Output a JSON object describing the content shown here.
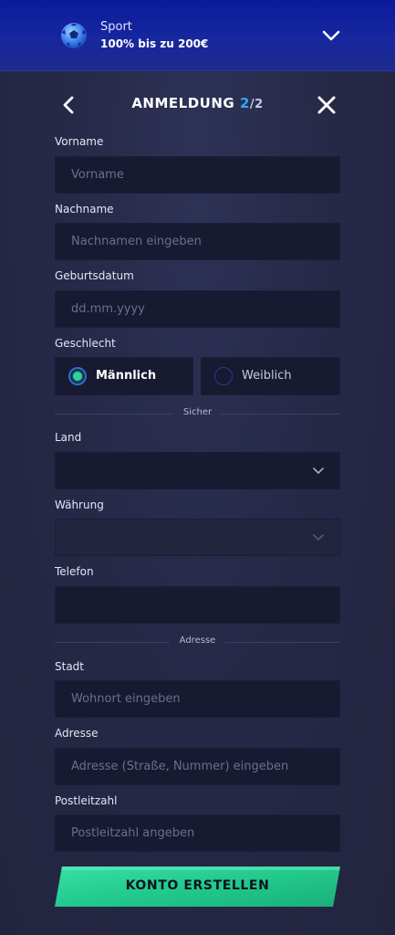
{
  "banner": {
    "category": "Sport",
    "promo": "100% bis zu 200€"
  },
  "header": {
    "title": "ANMELDUNG",
    "step": "2",
    "total": "/2"
  },
  "fields": {
    "first_name": {
      "label": "Vorname",
      "placeholder": "Vorname",
      "value": ""
    },
    "last_name": {
      "label": "Nachname",
      "placeholder": "Nachnamen eingeben",
      "value": ""
    },
    "birthdate": {
      "label": "Geburtsdatum",
      "placeholder": "dd.mm.yyyy",
      "value": ""
    },
    "gender": {
      "label": "Geschlecht",
      "options": [
        "Männlich",
        "Weiblich"
      ],
      "selected": "Männlich"
    },
    "country": {
      "label": "Land",
      "value": ""
    },
    "currency": {
      "label": "Währung",
      "value": "",
      "disabled": true
    },
    "phone": {
      "label": "Telefon",
      "value": ""
    },
    "city": {
      "label": "Stadt",
      "placeholder": "Wohnort eingeben",
      "value": ""
    },
    "address": {
      "label": "Adresse",
      "placeholder": "Adresse (Straße, Nummer) eingeben",
      "value": ""
    },
    "postcode": {
      "label": "Postleitzahl",
      "placeholder": "Postleitzahl angeben",
      "value": ""
    }
  },
  "dividers": {
    "secure": "Sicher",
    "address": "Adresse"
  },
  "submit_label": "KONTO ERSTELLEN",
  "colors": {
    "accent_blue": "#2fa8ff",
    "accent_green": "#27d6a0",
    "banner": "#17279e",
    "input_bg": "#171a30"
  },
  "icons": {
    "banner": "soccer-ball-icon",
    "expand": "chevron-down-icon",
    "back": "chevron-left-icon",
    "close": "close-icon"
  }
}
